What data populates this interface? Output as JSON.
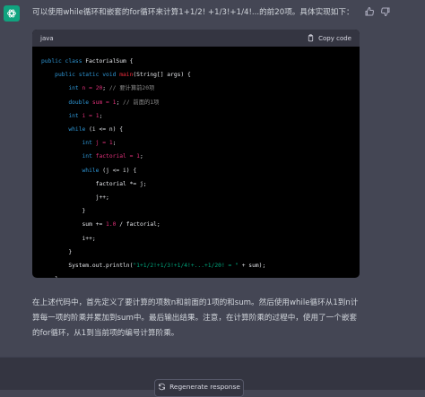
{
  "message": {
    "intro": "可以使用while循环和嵌套的for循环来计算1+1/2! +1/3!+1/4!...的前20项。具体实现如下：",
    "explanation": "在上述代码中，首先定义了要计算的项数n和前面的1项的和sum。然后使用while循环从1到n计算每一项的阶乘并累加到sum中。最后输出结果。注意，在计算阶乘的过程中，使用了一个嵌套的for循环，从1到当前项的编号计算阶乘。"
  },
  "code_block": {
    "language": "java",
    "copy_label": "Copy code",
    "lines": {
      "l1a": "public class",
      "l1b": " FactorialSum {",
      "l2a": "public static void",
      "l2b": "main",
      "l2c": "(String[] args) {",
      "l3a": "int",
      "l3b": " n = ",
      "l3c": "20",
      "l3d": "; ",
      "l3e": "// 要计算前20项",
      "l4a": "double",
      "l4b": " sum = ",
      "l4c": "1",
      "l4d": "; ",
      "l4e": "// 前面的1项",
      "l5a": "int",
      "l5b": " i = ",
      "l5c": "1",
      "l5d": ";",
      "l6a": "while",
      "l6b": " (i <= n) {",
      "l7a": "int",
      "l7b": " j = ",
      "l7c": "1",
      "l7d": ";",
      "l8a": "int",
      "l8b": " factorial = ",
      "l8c": "1",
      "l8d": ";",
      "l9a": "while",
      "l9b": " (j <= i) {",
      "l10": "factorial *= j;",
      "l11": "j++;",
      "l12": "}",
      "l13a": "sum += ",
      "l13b": "1.0",
      "l13c": " / factorial;",
      "l14": "i++;",
      "l15": "}",
      "l16a": "System.out.println(",
      "l16b": "\"1+1/2!+1/3!+1/4!+...+1/20! = \"",
      "l16c": " + sum);",
      "l17": "}",
      "l18": "}"
    }
  },
  "footer": {
    "regenerate_label": "Regenerate response"
  },
  "colors": {
    "accent": "#10a37f",
    "background": "#444654",
    "code_bg": "#000000"
  }
}
